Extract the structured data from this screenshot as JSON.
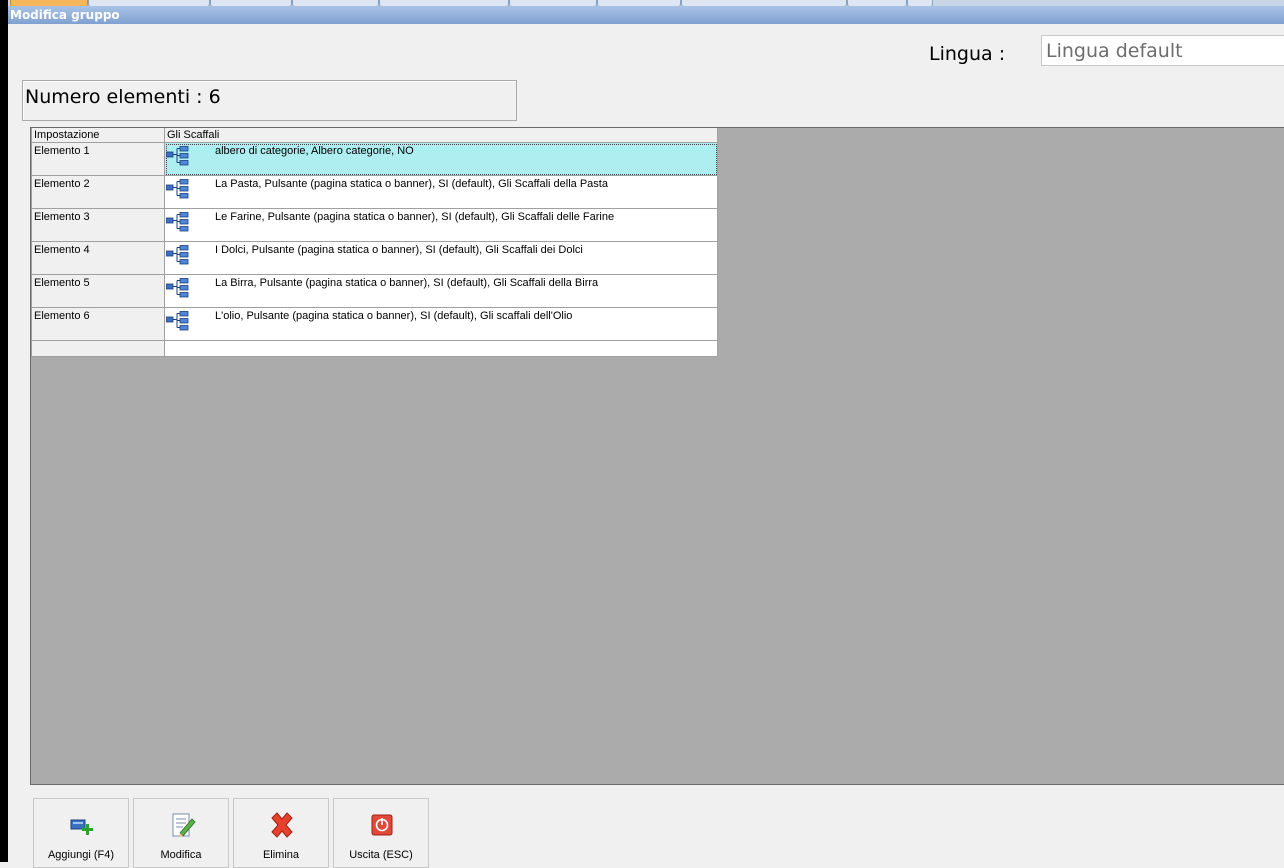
{
  "window": {
    "title": "Modifica gruppo"
  },
  "lingua": {
    "label": "Lingua :",
    "value": "Lingua default"
  },
  "count": {
    "text": "Numero elementi : 6"
  },
  "grid": {
    "columns": [
      "Impostazione",
      "Gli Scaffali"
    ],
    "rows": [
      {
        "label": "Elemento 1",
        "value": "albero di categorie, Albero categorie, NO",
        "selected": true
      },
      {
        "label": "Elemento 2",
        "value": "La Pasta, Pulsante (pagina statica o banner), SI (default), Gli Scaffali della Pasta"
      },
      {
        "label": "Elemento 3",
        "value": "Le Farine, Pulsante (pagina statica o banner), SI (default), Gli Scaffali delle Farine"
      },
      {
        "label": "Elemento 4",
        "value": "I Dolci, Pulsante (pagina statica o banner), SI (default), Gli Scaffali dei Dolci"
      },
      {
        "label": "Elemento 5",
        "value": "La Birra, Pulsante (pagina statica o banner), SI (default), Gli Scaffali della Birra"
      },
      {
        "label": "Elemento 6",
        "value": "L'olio, Pulsante (pagina statica o banner), SI (default), Gli scaffali dell'Olio"
      }
    ],
    "row_icon": "tree-structure-icon"
  },
  "toolbar": {
    "add_label": "Aggiungi (F4)",
    "edit_label": "Modifica",
    "delete_label": "Elimina",
    "exit_label": "Uscita (ESC)"
  },
  "colors": {
    "selected_row": "#aeeef1",
    "titlebar": "#7fa1d0",
    "grid_background": "#ababab"
  }
}
